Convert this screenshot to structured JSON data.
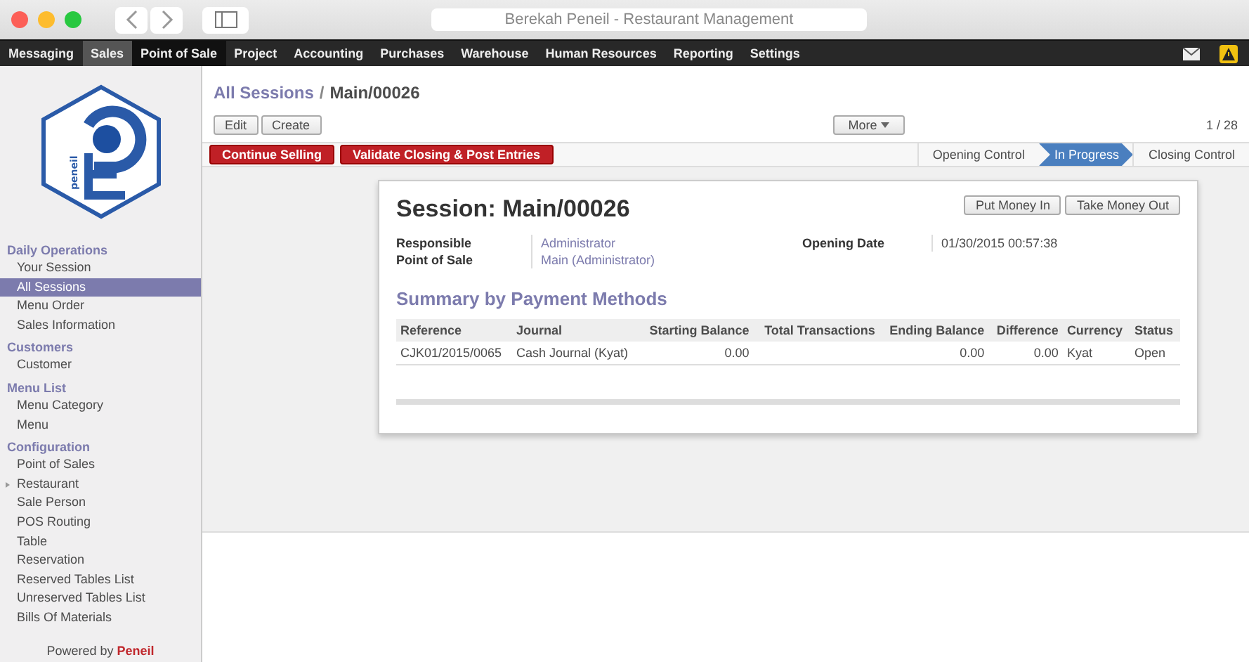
{
  "window": {
    "title": "Berekah Peneil - Restaurant Management"
  },
  "menu": [
    {
      "label": "Messaging",
      "selected": false,
      "hovered": false
    },
    {
      "label": "Sales",
      "selected": false,
      "hovered": true
    },
    {
      "label": "Point of Sale",
      "selected": true,
      "hovered": false
    },
    {
      "label": "Project",
      "selected": false,
      "hovered": false
    },
    {
      "label": "Accounting",
      "selected": false,
      "hovered": false
    },
    {
      "label": "Purchases",
      "selected": false,
      "hovered": false
    },
    {
      "label": "Warehouse",
      "selected": false,
      "hovered": false
    },
    {
      "label": "Human Resources",
      "selected": false,
      "hovered": false
    },
    {
      "label": "Reporting",
      "selected": false,
      "hovered": false
    },
    {
      "label": "Settings",
      "selected": false,
      "hovered": false
    }
  ],
  "logo_text": "peneil",
  "sidebar": {
    "sections": [
      {
        "title": "Daily Operations",
        "items": [
          {
            "label": "Your Session",
            "selected": false
          },
          {
            "label": "All Sessions",
            "selected": true
          },
          {
            "label": "Menu Order",
            "selected": false
          },
          {
            "label": "Sales Information",
            "selected": false
          }
        ]
      },
      {
        "title": "Customers",
        "items": [
          {
            "label": "Customer",
            "selected": false
          }
        ]
      },
      {
        "title": "Menu List",
        "items": [
          {
            "label": "Menu Category",
            "selected": false
          },
          {
            "label": "Menu",
            "selected": false
          }
        ]
      },
      {
        "title": "Configuration",
        "items": [
          {
            "label": "Point of Sales",
            "selected": false
          },
          {
            "label": "Restaurant",
            "selected": false,
            "expandable": true
          },
          {
            "label": "Sale Person",
            "selected": false
          },
          {
            "label": "POS Routing",
            "selected": false
          },
          {
            "label": "Table",
            "selected": false
          },
          {
            "label": "Reservation",
            "selected": false
          },
          {
            "label": "Reserved Tables List",
            "selected": false
          },
          {
            "label": "Unreserved Tables List",
            "selected": false
          },
          {
            "label": "Bills Of Materials",
            "selected": false
          }
        ]
      }
    ],
    "footer_prefix": "Powered by",
    "footer_brand": "Peneil"
  },
  "breadcrumb": {
    "parent": "All Sessions",
    "separator": "/",
    "current": "Main/00026"
  },
  "toolbar": {
    "buttons": [
      "Edit",
      "Create"
    ],
    "more": "More",
    "pager": "1 / 28"
  },
  "actions": [
    "Continue Selling",
    "Validate Closing & Post Entries"
  ],
  "stages": [
    {
      "label": "Opening Control",
      "selected": false
    },
    {
      "label": "In Progress",
      "selected": true
    },
    {
      "label": "Closing Control",
      "selected": false
    }
  ],
  "form": {
    "title": "Session: Main/00026",
    "buttons": [
      "Put Money In",
      "Take Money Out"
    ],
    "fields_left": [
      {
        "label": "Responsible",
        "value": "Administrator"
      },
      {
        "label": "Point of Sale",
        "value": "Main (Administrator)"
      }
    ],
    "fields_right": [
      {
        "label": "Opening Date",
        "value": "01/30/2015 00:57:38"
      }
    ],
    "section": "Summary by Payment Methods",
    "table": {
      "columns": [
        "Reference",
        "Journal",
        "Starting Balance",
        "Total Transactions",
        "Ending Balance",
        "Difference",
        "Currency",
        "Status"
      ],
      "rows": [
        [
          "CJK01/2015/0065",
          "Cash Journal (Kyat)",
          "0.00",
          "",
          "0.00",
          "0.00",
          "Kyat",
          "Open"
        ]
      ]
    }
  }
}
